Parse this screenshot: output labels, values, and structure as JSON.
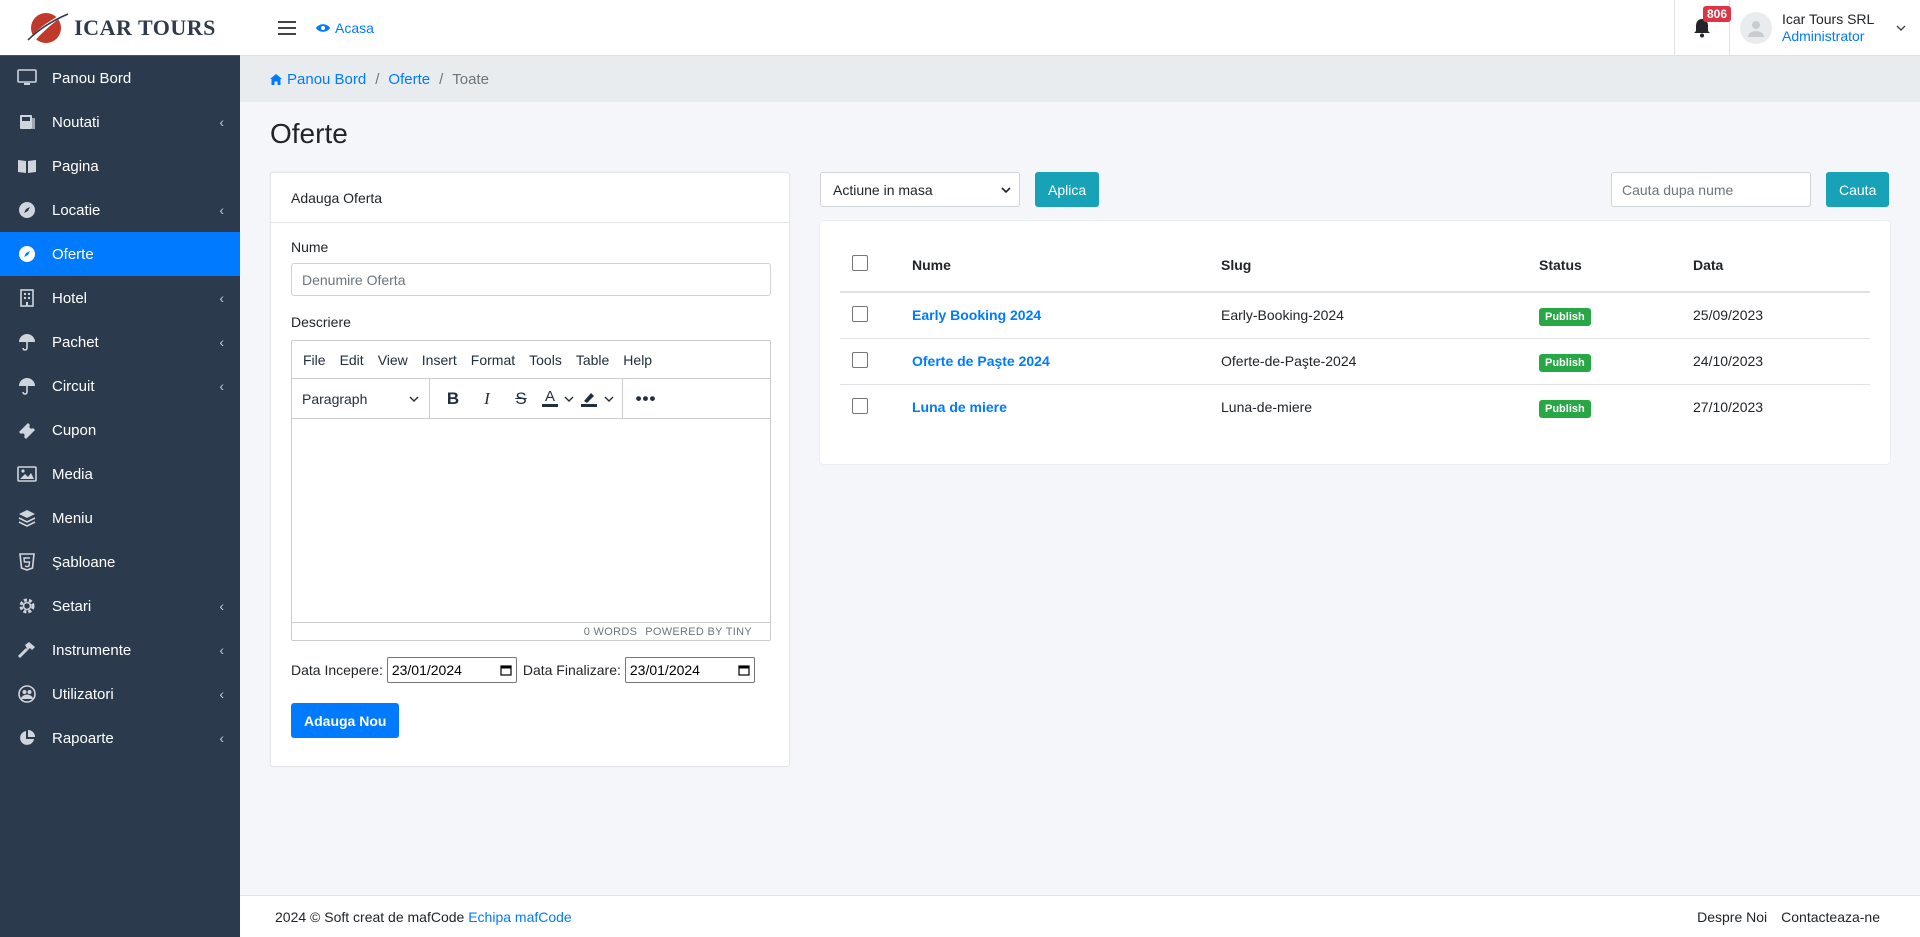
{
  "brand": {
    "name": "ICAR TOURS"
  },
  "sidebar": {
    "items": [
      {
        "label": "Panou Bord",
        "icon": "monitor-icon",
        "expandable": false
      },
      {
        "label": "Noutati",
        "icon": "newspaper-icon",
        "expandable": true
      },
      {
        "label": "Pagina",
        "icon": "book-open-icon",
        "expandable": false
      },
      {
        "label": "Locatie",
        "icon": "compass-icon",
        "expandable": true
      },
      {
        "label": "Oferte",
        "icon": "compass-icon",
        "expandable": false,
        "active": true
      },
      {
        "label": "Hotel",
        "icon": "building-icon",
        "expandable": true
      },
      {
        "label": "Pachet",
        "icon": "umbrella-icon",
        "expandable": true
      },
      {
        "label": "Circuit",
        "icon": "umbrella-icon",
        "expandable": true
      },
      {
        "label": "Cupon",
        "icon": "ticket-icon",
        "expandable": false
      },
      {
        "label": "Media",
        "icon": "image-icon",
        "expandable": false
      },
      {
        "label": "Meniu",
        "icon": "layers-icon",
        "expandable": false
      },
      {
        "label": "Şabloane",
        "icon": "html5-icon",
        "expandable": false
      },
      {
        "label": "Setari",
        "icon": "gear-icon",
        "expandable": true
      },
      {
        "label": "Instrumente",
        "icon": "hammer-icon",
        "expandable": true
      },
      {
        "label": "Utilizatori",
        "icon": "users-icon",
        "expandable": true
      },
      {
        "label": "Rapoarte",
        "icon": "pie-chart-icon",
        "expandable": true
      }
    ]
  },
  "topbar": {
    "home_label": "Acasa",
    "notification_count": "806",
    "user_name": "Icar Tours SRL",
    "user_role": "Administrator"
  },
  "breadcrumb": {
    "items": [
      "Panou Bord",
      "Oferte",
      "Toate"
    ]
  },
  "page": {
    "title": "Oferte"
  },
  "form": {
    "header": "Adauga Oferta",
    "name_label": "Nume",
    "name_placeholder": "Denumire Oferta",
    "desc_label": "Descriere",
    "editor_menu": [
      "File",
      "Edit",
      "View",
      "Insert",
      "Format",
      "Tools",
      "Table",
      "Help"
    ],
    "editor_block_format": "Paragraph",
    "editor_word_count": "0 WORDS",
    "editor_powered": "POWERED BY TINY",
    "start_label": "Data Incepere:",
    "start_value": "23/01/2024",
    "end_label": "Data Finalizare:",
    "end_value": "23/01/2024",
    "submit_label": "Adauga Nou"
  },
  "list": {
    "bulk_action": "Actiune in masa",
    "apply_label": "Aplica",
    "search_placeholder": "Cauta dupa nume",
    "search_button": "Cauta",
    "columns": [
      "Nume",
      "Slug",
      "Status",
      "Data"
    ],
    "rows": [
      {
        "name": "Early Booking 2024",
        "slug": "Early-Booking-2024",
        "status": "Publish",
        "date": "25/09/2023"
      },
      {
        "name": "Oferte de Paşte 2024",
        "slug": "Oferte-de-Paşte-2024",
        "status": "Publish",
        "date": "24/10/2023"
      },
      {
        "name": "Luna de miere",
        "slug": "Luna-de-miere",
        "status": "Publish",
        "date": "27/10/2023"
      }
    ]
  },
  "footer": {
    "copyright": "2024 © Soft creat de mafCode",
    "team_link": "Echipa mafCode",
    "links": [
      "Despre Noi",
      "Contacteaza-ne"
    ]
  },
  "colors": {
    "primary": "#007bff",
    "info": "#17a2b8",
    "success": "#28a745",
    "danger": "#dc3545",
    "sidebar": "#2c3a4e"
  }
}
